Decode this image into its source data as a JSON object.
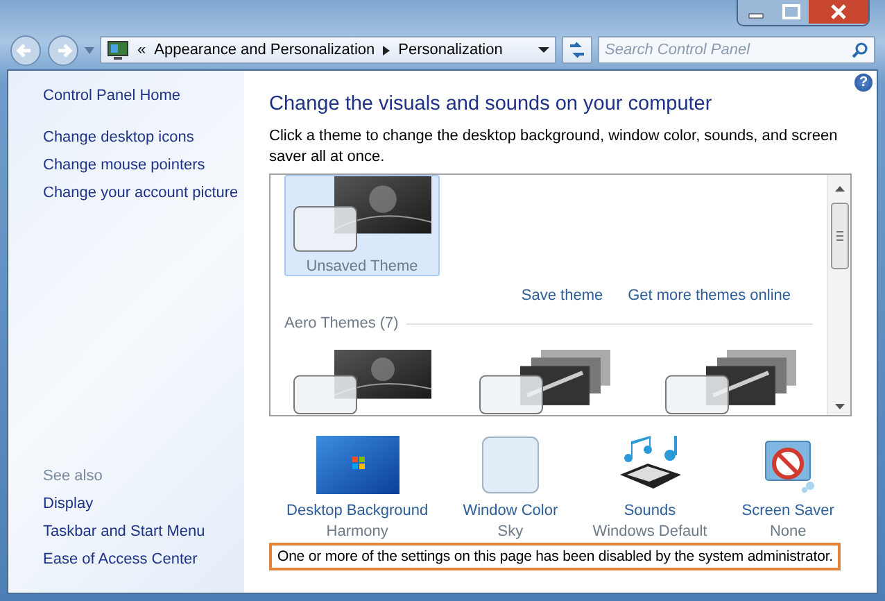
{
  "address_bar": {
    "overflow": "«",
    "path": [
      "Appearance and Personalization",
      "Personalization"
    ]
  },
  "search": {
    "placeholder": "Search Control Panel"
  },
  "sidebar": {
    "home": "Control Panel Home",
    "tasks": [
      "Change desktop icons",
      "Change mouse pointers",
      "Change your account picture"
    ],
    "see_also": {
      "heading": "See also",
      "links": [
        "Display",
        "Taskbar and Start Menu",
        "Ease of Access Center"
      ]
    }
  },
  "main": {
    "help": "?",
    "heading": "Change the visuals and sounds on your computer",
    "description": "Click a theme to change the desktop background, window color, sounds, and screen saver all at once.",
    "themes": {
      "items": [
        {
          "kind": "single",
          "label": "Unsaved Theme",
          "selected": true
        }
      ],
      "links": [
        "Save theme",
        "Get more themes online"
      ],
      "groups": [
        {
          "heading": "Aero Themes (7)",
          "items": [
            {
              "kind": "single",
              "selected": false
            },
            {
              "kind": "stack",
              "selected": false
            },
            {
              "kind": "stack",
              "selected": false
            }
          ]
        }
      ]
    },
    "settings": [
      {
        "kind": "background",
        "label": "Desktop Background",
        "value": "Harmony"
      },
      {
        "kind": "color",
        "label": "Window Color",
        "value": "Sky"
      },
      {
        "kind": "sounds",
        "label": "Sounds",
        "value": "Windows Default"
      },
      {
        "kind": "screensaver",
        "label": "Screen Saver",
        "value": "None"
      }
    ],
    "notice": "One or more of the settings on this page has been disabled by the system administrator."
  }
}
